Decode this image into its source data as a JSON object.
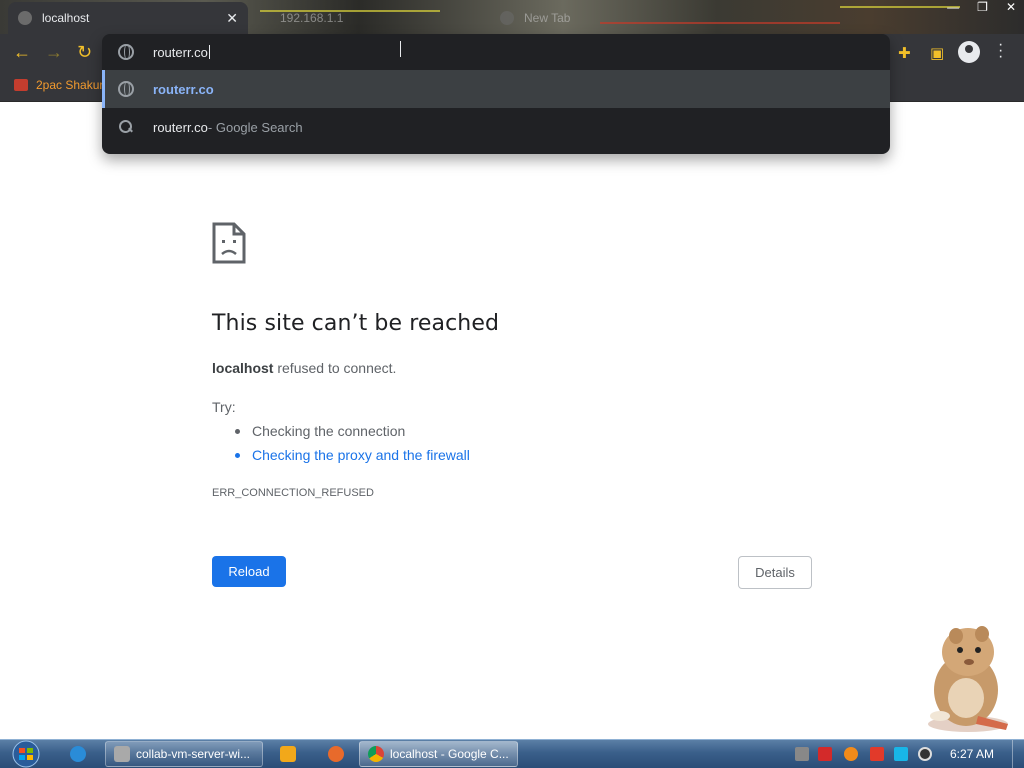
{
  "browser": {
    "tabs": [
      {
        "title": "localhost",
        "active": true
      },
      {
        "title": "192.168.1.1",
        "active": false
      },
      {
        "title": "New Tab",
        "active": false
      }
    ],
    "tab_close_glyph": "✕",
    "bookmarks": [
      {
        "label": "2pac Shakur"
      }
    ],
    "accent_color": "#f2c02a"
  },
  "omnibox": {
    "input_value": "routerr.co",
    "suggestions": [
      {
        "icon": "globe-icon",
        "text": "routerr.co",
        "subtext": ""
      },
      {
        "icon": "search-icon",
        "text": "routerr.co",
        "subtext": " - Google Search"
      }
    ]
  },
  "error_page": {
    "headline": "This site can’t be reached",
    "host": "localhost",
    "message": " refused to connect.",
    "try_label": "Try:",
    "suggestions": [
      {
        "text": "Checking the connection",
        "link": false
      },
      {
        "text": "Checking the proxy and the firewall",
        "link": true
      }
    ],
    "error_code": "ERR_CONNECTION_REFUSED",
    "reload_label": "Reload",
    "details_label": "Details",
    "link_color": "#1a73e8"
  },
  "taskbar": {
    "items": [
      {
        "label": "collab-vm-server-wi..."
      },
      {
        "label": "localhost - Google C..."
      }
    ],
    "clock": "6:27 AM"
  }
}
